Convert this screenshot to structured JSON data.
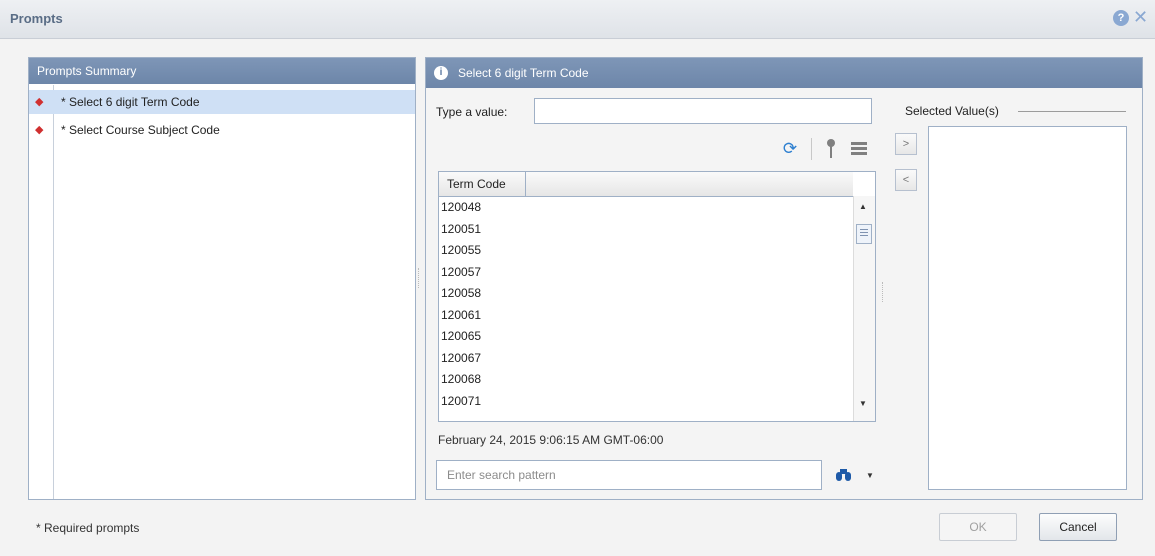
{
  "dialog": {
    "title": "Prompts",
    "help_icon": "question-circle-icon",
    "close_icon": "close-icon"
  },
  "summary": {
    "header": "Prompts Summary",
    "items": [
      {
        "label": "* Select 6 digit Term Code",
        "selected": true
      },
      {
        "label": "* Select Course Subject Code",
        "selected": false
      }
    ]
  },
  "prompt": {
    "header_title": "Select 6 digit Term Code",
    "type_value_label": "Type a value:",
    "type_value": "",
    "toolbar_icons": [
      "refresh-icon",
      "key-icon",
      "list-icon"
    ],
    "column_header": "Term Code",
    "values": [
      "120048",
      "120051",
      "120055",
      "120057",
      "120058",
      "120061",
      "120065",
      "120067",
      "120068",
      "120071"
    ],
    "timestamp": "February 24, 2015 9:06:15 AM GMT-06:00",
    "search_placeholder": "Enter search pattern"
  },
  "selected": {
    "label": "Selected Value(s)",
    "add_label": ">",
    "remove_label": "<",
    "values": []
  },
  "footer": {
    "required_note": "* Required prompts",
    "ok_label": "OK",
    "cancel_label": "Cancel"
  },
  "colors": {
    "header_blue": "#7890b2",
    "selection": "#cfe0f5",
    "required_marker": "#d03030"
  }
}
